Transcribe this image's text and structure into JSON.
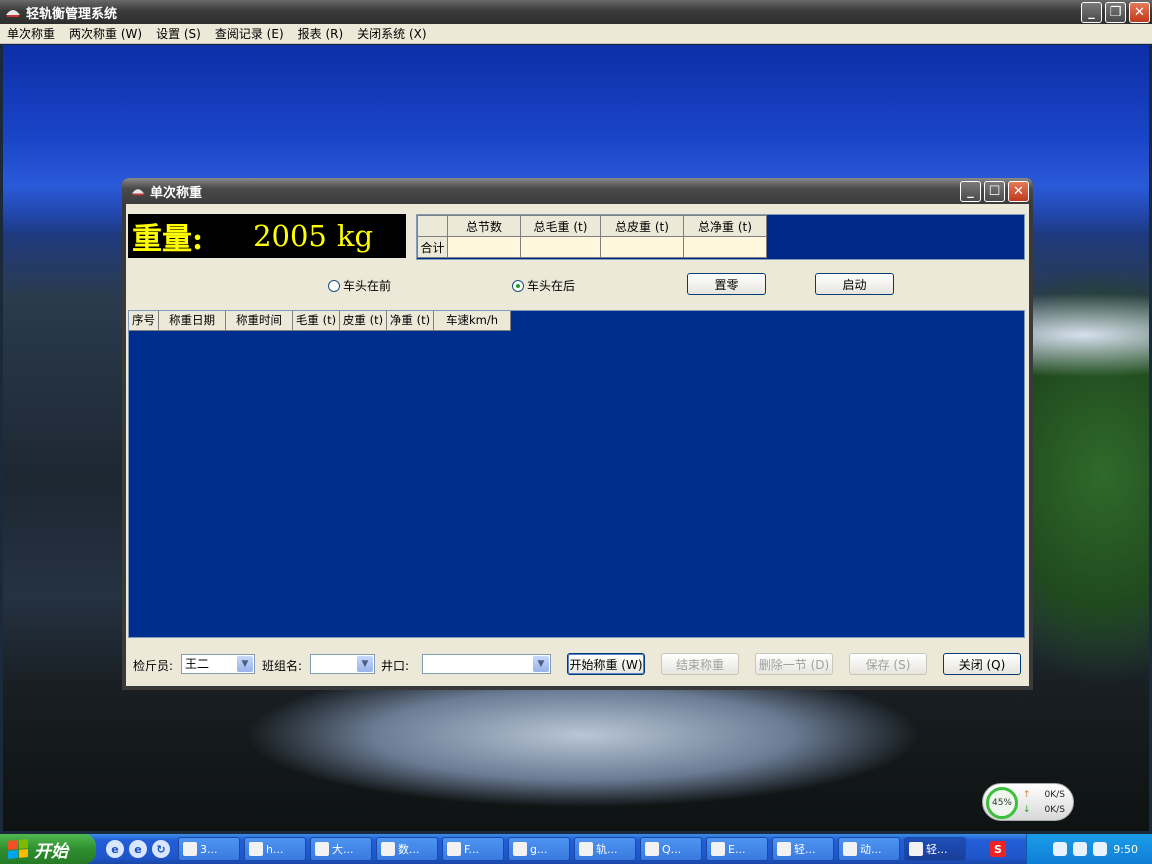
{
  "app": {
    "title": "轻轨衡管理系统",
    "menu": [
      "单次称重",
      "两次称重 (W)",
      "设置 (S)",
      "查阅记录 (E)",
      "报表 (R)",
      "关闭系统 (X)"
    ]
  },
  "dialog": {
    "title": "单次称重",
    "weight": {
      "label": "重量:",
      "value": "2005",
      "unit": "kg"
    },
    "summary": {
      "headers": [
        "总节数",
        "总毛重 (t)",
        "总皮重 (t)",
        "总净重 (t)"
      ],
      "row_label": "合计"
    },
    "radios": {
      "front": "车头在前",
      "back": "车头在后",
      "selected": "back"
    },
    "buttons": {
      "zero": "置零",
      "start": "启动",
      "begin_weigh": "开始称重 (W)",
      "end_weigh": "结束称重",
      "delete_one": "删除一节 (D)",
      "save": "保存 (S)",
      "close": "关闭 (Q)"
    },
    "grid_headers": [
      "序号",
      "称重日期",
      "称重时间",
      "毛重 (t)",
      "皮重 (t)",
      "净重 (t)",
      "车速km/h"
    ],
    "fields": {
      "inspector_label": "检斤员:",
      "inspector_value": "王二",
      "shift_label": "班组名:",
      "shift_value": "",
      "mine_label": "井口:",
      "mine_value": ""
    }
  },
  "taskbar": {
    "start_label": "开始",
    "tasks": [
      "3...",
      "h...",
      "大...",
      "数...",
      "F...",
      "g...",
      "轨...",
      "Q...",
      "E...",
      "轻...",
      "动...",
      "轻..."
    ],
    "clock": "9:50"
  },
  "net_widget": {
    "percent": "45%",
    "up": "0K/S",
    "down": "0K/S"
  },
  "colors": {
    "grid_bg": "#002e8f",
    "weight_text": "#ffff00",
    "title_bar": "#3c3c3c"
  }
}
